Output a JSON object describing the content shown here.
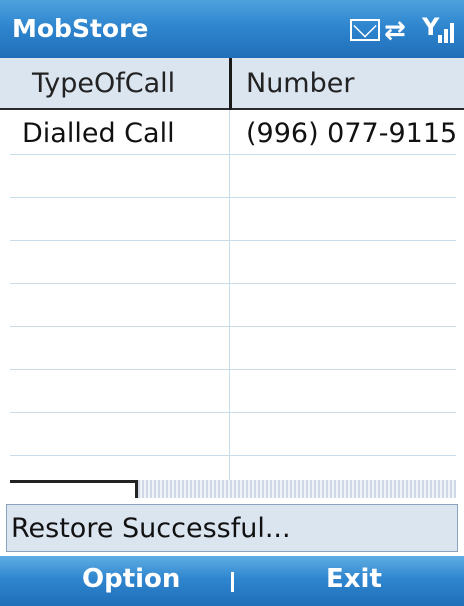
{
  "app": {
    "title": "MobStore"
  },
  "status_icons": [
    "envelope-icon",
    "data-connection-icon",
    "signal-strength-icon"
  ],
  "table": {
    "columns": [
      "TypeOfCall",
      "Number"
    ],
    "rows": [
      [
        "Dialled Call",
        "(996) 077-9115"
      ]
    ]
  },
  "status_message": "Restore Successful...",
  "softkeys": {
    "left": "Option",
    "right": "Exit"
  },
  "colors": {
    "bar_blue": "#2f86cf",
    "header_bg": "#dbe5f0",
    "grid_line": "#c8dcea"
  }
}
